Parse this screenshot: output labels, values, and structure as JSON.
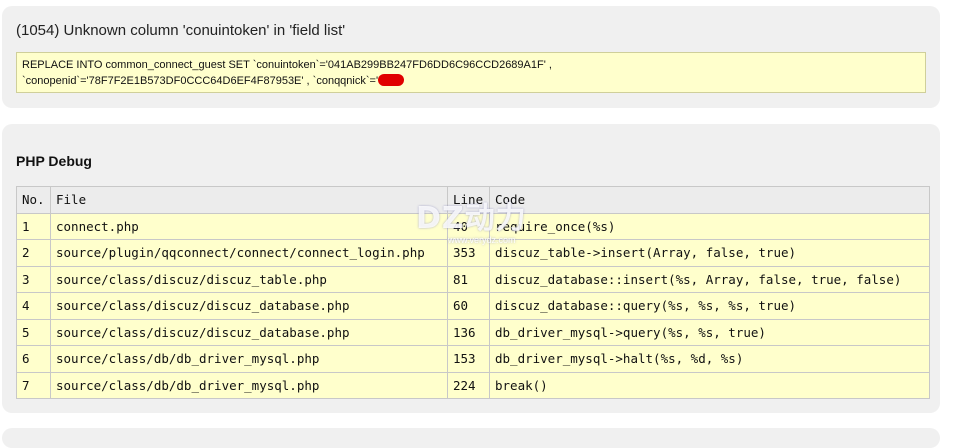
{
  "error": {
    "title": "(1054) Unknown column 'conuintoken' in 'field list'",
    "sql_line1": "REPLACE INTO common_connect_guest SET `conuintoken`='041AB299BB247FD6DD6C96CCD2689A1F' ,",
    "sql_line2": "`conopenid`='78F7F2E1B573DF0CCC64D6EF4F87953E' , `conqqnick`='"
  },
  "debug": {
    "title": "PHP Debug",
    "headers": {
      "no": "No.",
      "file": "File",
      "line": "Line",
      "code": "Code"
    },
    "rows": [
      {
        "no": "1",
        "file": "connect.php",
        "line": "40",
        "code": "require_once(%s)"
      },
      {
        "no": "2",
        "file": "source/plugin/qqconnect/connect/connect_login.php",
        "line": "353",
        "code": "discuz_table->insert(Array, false, true)"
      },
      {
        "no": "3",
        "file": "source/class/discuz/discuz_table.php",
        "line": "81",
        "code": "discuz_database::insert(%s, Array, false, true, false)"
      },
      {
        "no": "4",
        "file": "source/class/discuz/discuz_database.php",
        "line": "60",
        "code": "discuz_database::query(%s, %s, %s, true)"
      },
      {
        "no": "5",
        "file": "source/class/discuz/discuz_database.php",
        "line": "136",
        "code": "db_driver_mysql->query(%s, %s, true)"
      },
      {
        "no": "6",
        "file": "source/class/db/db_driver_mysql.php",
        "line": "153",
        "code": "db_driver_mysql->halt(%s, %d, %s)"
      },
      {
        "no": "7",
        "file": "source/class/db/db_driver_mysql.php",
        "line": "224",
        "code": "break()"
      }
    ]
  },
  "watermark": {
    "main": "DZ动力",
    "sub": "www.verydz.com"
  },
  "colors": {
    "sql_bg": "#ffffcc",
    "panel_bg": "#f0f0f0",
    "redaction": "#e00000"
  }
}
